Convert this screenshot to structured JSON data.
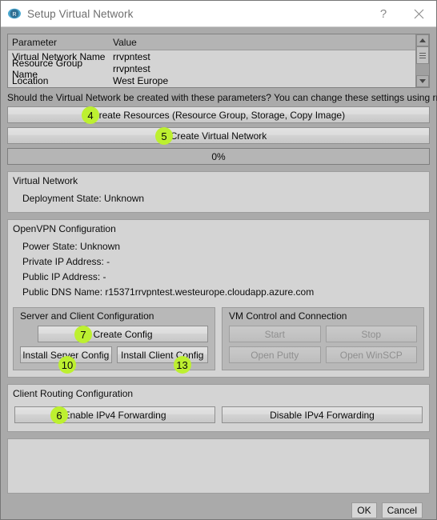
{
  "window": {
    "title": "Setup Virtual Network",
    "icon": "app-icon",
    "help_label": "?",
    "close_label": "✕"
  },
  "parameters": {
    "headers": [
      "Parameter",
      "Value"
    ],
    "rows": [
      {
        "parameter": "Virtual Network Name",
        "value": "rrvpntest"
      },
      {
        "parameter": "Resource Group Name",
        "value": "rrvpntest"
      },
      {
        "parameter": "Location",
        "value": "West Europe"
      }
    ]
  },
  "prompt": "Should the Virtual Network be created with these parameters? You can change these settings using rrConfig.",
  "actions": {
    "create_resources": "Create Resources (Resource Group, Storage, Copy Image)",
    "create_virtual_network": "Create Virtual Network",
    "progress_text": "0%",
    "progress_percent": 0
  },
  "virtual_network": {
    "title": "Virtual Network",
    "deployment_state": "Deployment State: Unknown"
  },
  "openvpn": {
    "title": "OpenVPN Configuration",
    "power_state": "Power State: Unknown",
    "private_ip": "Private IP Address: -",
    "public_ip": "Public IP Address: -",
    "public_dns": "Public DNS Name: r15371rrvpntest.westeurope.cloudapp.azure.com",
    "server_client": {
      "title": "Server and Client Configuration",
      "create_config": "Create Config",
      "install_server_config": "Install Server Config",
      "install_client_config": "Install Client Config"
    },
    "vm_control": {
      "title": "VM Control and Connection",
      "start": "Start",
      "stop": "Stop",
      "open_putty": "Open Putty",
      "open_winscp": "Open WinSCP"
    }
  },
  "client_routing": {
    "title": "Client Routing Configuration",
    "enable_ipv4_forwarding": "Enable IPv4 Forwarding",
    "disable_ipv4_forwarding": "Disable IPv4 Forwarding"
  },
  "log": {
    "content": ""
  },
  "footer": {
    "ok": "OK",
    "cancel": "Cancel"
  },
  "badges": {
    "create_resources": "4",
    "create_virtual_network": "5",
    "enable_ipv4_forwarding": "6",
    "create_config": "7",
    "install_server_config": "10",
    "install_client_config": "13"
  },
  "colors": {
    "badge_green": "#bdf030",
    "window_bg": "#aaaaaa",
    "panel_bg": "#d4d4d4"
  }
}
